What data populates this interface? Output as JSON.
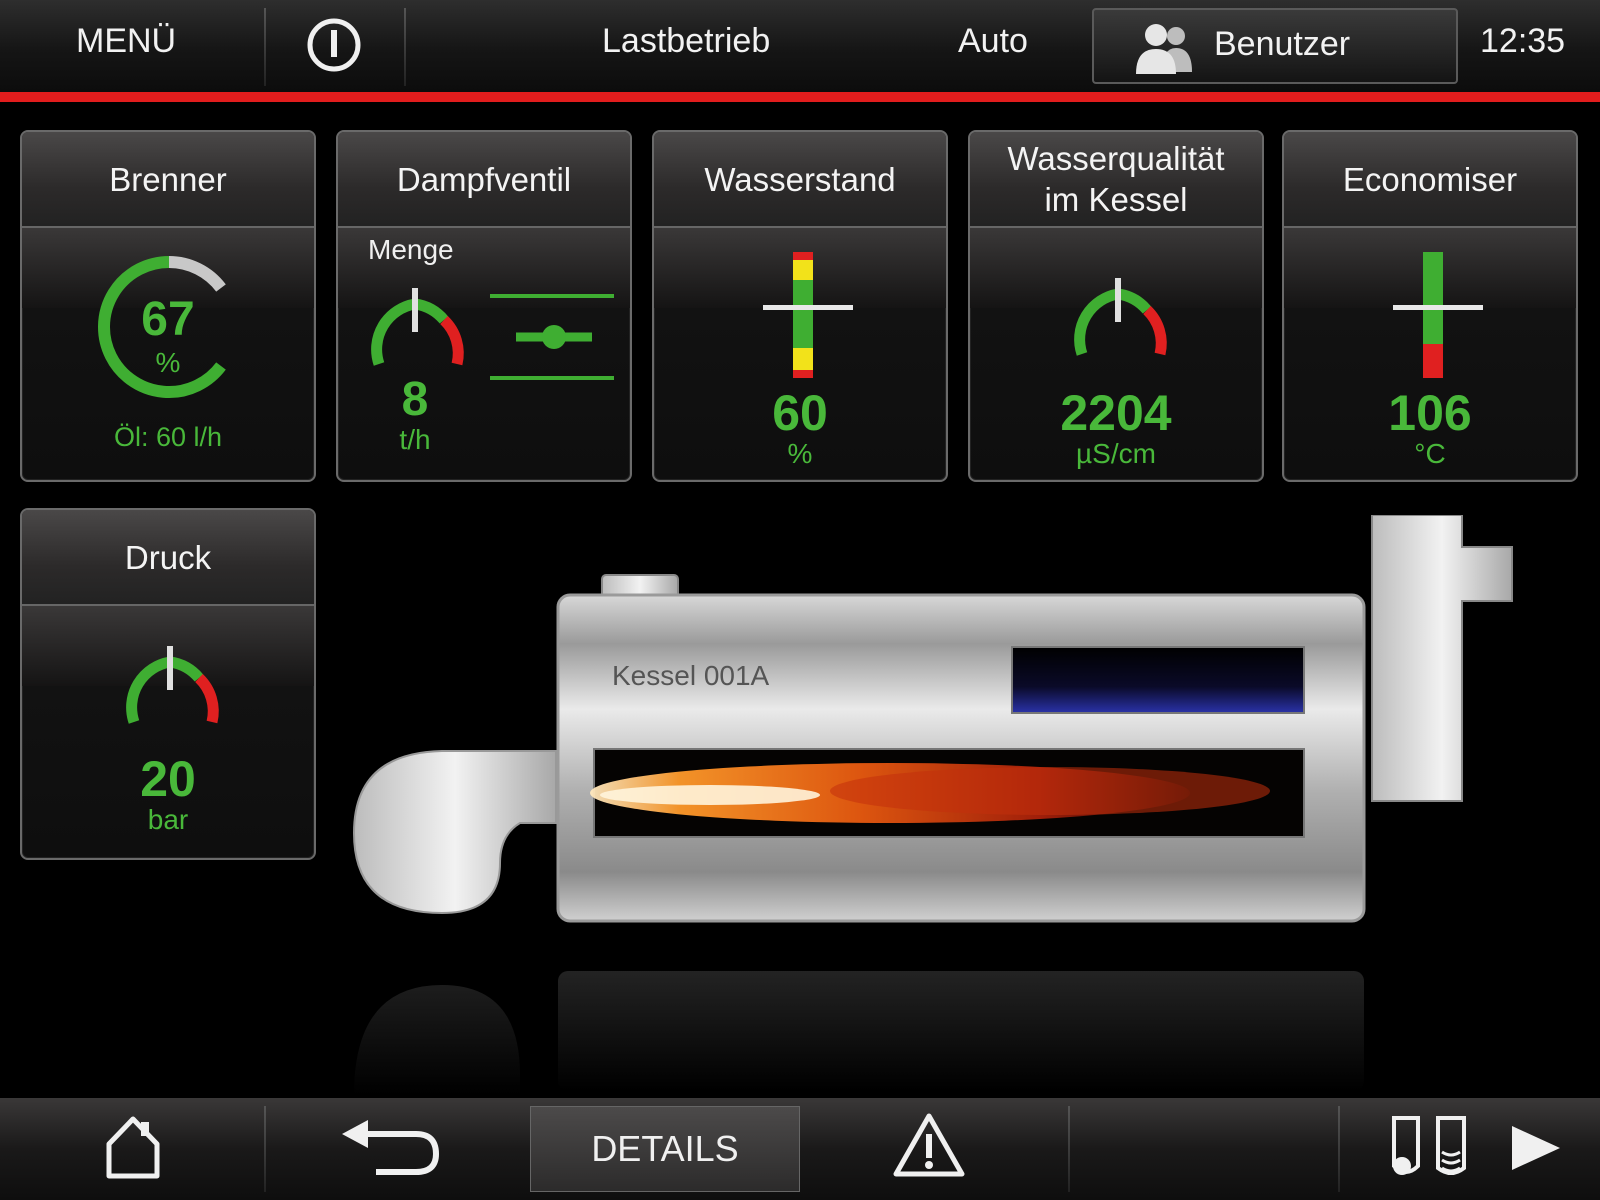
{
  "topbar": {
    "menu_label": "MENÜ",
    "mode_label": "Lastbetrieb",
    "auto_label": "Auto",
    "user_label": "Benutzer",
    "time": "12:35"
  },
  "tiles": {
    "brenner": {
      "title": "Brenner",
      "value": "67",
      "unit": "%",
      "fuel": "Öl: 60 l/h",
      "level": 0.67
    },
    "dampfventil": {
      "title": "Dampfventil",
      "sublabel": "Menge",
      "value": "8",
      "unit": "t/h"
    },
    "wasserstand": {
      "title": "Wasserstand",
      "value": "60",
      "unit": "%"
    },
    "wasserqualitaet": {
      "title": "Wasserqualität\nim Kessel",
      "value": "2204",
      "unit": "µS/cm"
    },
    "economiser": {
      "title": "Economiser",
      "value": "106",
      "unit": "°C"
    },
    "druck": {
      "title": "Druck",
      "value": "20",
      "unit": "bar"
    }
  },
  "boiler": {
    "label": "Kessel 001A"
  },
  "bottombar": {
    "details_label": "DETAILS"
  },
  "colors": {
    "accent_red": "#e21d1d",
    "value_green": "#49b83a",
    "gauge_red": "#e02020",
    "gauge_yellow": "#f2e21a"
  },
  "icons": [
    "power-icon",
    "users-icon",
    "home-icon",
    "back-arrow-icon",
    "warning-icon",
    "tanks-icon",
    "play-icon"
  ]
}
